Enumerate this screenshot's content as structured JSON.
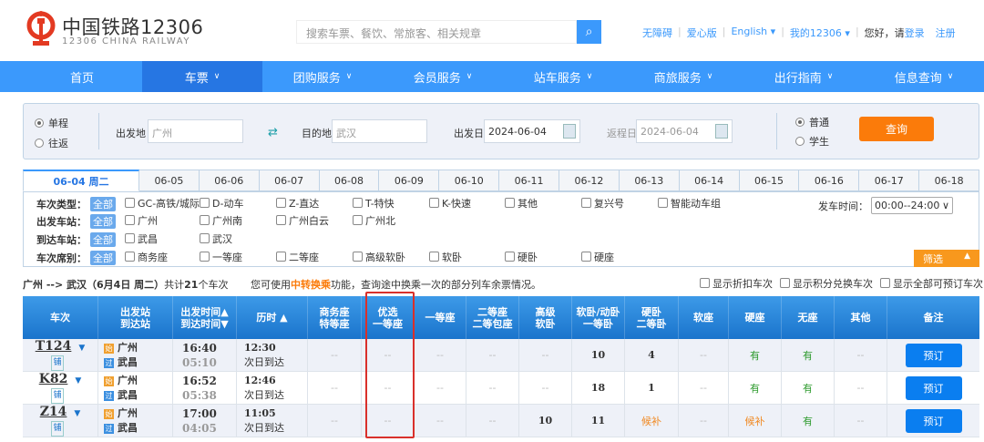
{
  "header": {
    "logo_title": "中国铁路12306",
    "logo_sub": "12306 CHINA RAILWAY",
    "search_placeholder": "搜索车票、餐饮、常旅客、相关规章",
    "links": [
      "无障碍",
      "爱心版",
      "English",
      "我的12306"
    ],
    "greeting": "您好，请",
    "login": "登录",
    "register": "注册"
  },
  "nav": [
    {
      "label": "首页"
    },
    {
      "label": "车票",
      "active": true
    },
    {
      "label": "团购服务"
    },
    {
      "label": "会员服务"
    },
    {
      "label": "站车服务"
    },
    {
      "label": "商旅服务"
    },
    {
      "label": "出行指南"
    },
    {
      "label": "信息查询"
    }
  ],
  "form": {
    "one_way": "单程",
    "round_trip": "往返",
    "from_label": "出发地",
    "from": "广州",
    "to_label": "目的地",
    "to": "武汉",
    "date_label": "出发日",
    "date": "2024-06-04",
    "return_label": "返程日",
    "return_date": "2024-06-04",
    "normal": "普通",
    "student": "学生",
    "query": "查询"
  },
  "date_tabs": [
    "06-04 周二",
    "06-05",
    "06-06",
    "06-07",
    "06-08",
    "06-09",
    "06-10",
    "06-11",
    "06-12",
    "06-13",
    "06-14",
    "06-15",
    "06-16",
    "06-17",
    "06-18"
  ],
  "filters": {
    "all": "全部",
    "type_label": "车次类型：",
    "types": [
      "GC-高铁/城际",
      "D-动车",
      "Z-直达",
      "T-特快",
      "K-快速",
      "其他",
      "复兴号",
      "智能动车组"
    ],
    "from_label": "出发车站：",
    "from_stations": [
      "广州",
      "广州南",
      "广州白云",
      "广州北"
    ],
    "to_label": "到达车站：",
    "to_stations": [
      "武昌",
      "武汉"
    ],
    "seat_label": "车次席别：",
    "seats": [
      "商务座",
      "一等座",
      "二等座",
      "高级软卧",
      "软卧",
      "硬卧",
      "硬座"
    ],
    "time_label": "发车时间：",
    "time_value": "00:00--24:00",
    "filter_btn": "筛选"
  },
  "summary": {
    "route": "广州 --> 武汉（6月4日  周二）",
    "total_pre": "共计",
    "count": "21",
    "total_post": "个车次",
    "transfer_pre": "您可使用",
    "transfer_link": "中转换乘",
    "transfer_post": "功能，查询途中换乘一次的部分列车余票情况。",
    "options": [
      "显示折扣车次",
      "显示积分兑换车次",
      "显示全部可预订车次"
    ]
  },
  "table": {
    "headers": [
      "车次",
      "出发站\n到达站",
      "出发时间▲\n到达时间▼",
      "历时 ▲",
      "商务座\n特等座",
      "优选\n一等座",
      "一等座",
      "二等座\n二等包座",
      "高级\n软卧",
      "软卧/动卧\n一等卧",
      "硬卧\n二等卧",
      "软座",
      "硬座",
      "无座",
      "其他",
      "备注"
    ],
    "rows": [
      {
        "train": "T124",
        "tag": "铺",
        "from": "广州",
        "to": "武昌",
        "dep": "16:40",
        "arr": "05:10",
        "dur": "12:30",
        "next": "次日到达",
        "seats": [
          "--",
          "--",
          "--",
          "--",
          "--",
          "10",
          "4",
          "--",
          "有",
          "有",
          "--"
        ],
        "book": "预订"
      },
      {
        "train": "K82",
        "tag": "铺",
        "from": "广州",
        "to": "武昌",
        "dep": "16:52",
        "arr": "05:38",
        "dur": "12:46",
        "next": "次日到达",
        "seats": [
          "--",
          "--",
          "--",
          "--",
          "--",
          "18",
          "1",
          "--",
          "有",
          "有",
          "--"
        ],
        "book": "预订"
      },
      {
        "train": "Z14",
        "tag": "铺",
        "from": "广州",
        "to": "武昌",
        "dep": "17:00",
        "arr": "04:05",
        "dur": "11:05",
        "next": "次日到达",
        "seats": [
          "--",
          "--",
          "--",
          "--",
          "10",
          "11",
          "候补",
          "--",
          "候补",
          "有",
          "--"
        ],
        "book": "预订"
      }
    ],
    "start_badge": "始",
    "pass_badge": "过"
  },
  "colors": {
    "brand": "#3b99fc",
    "nav_active": "#2676e3",
    "accent": "#fb7b0a",
    "highlight": "#d9302b"
  }
}
